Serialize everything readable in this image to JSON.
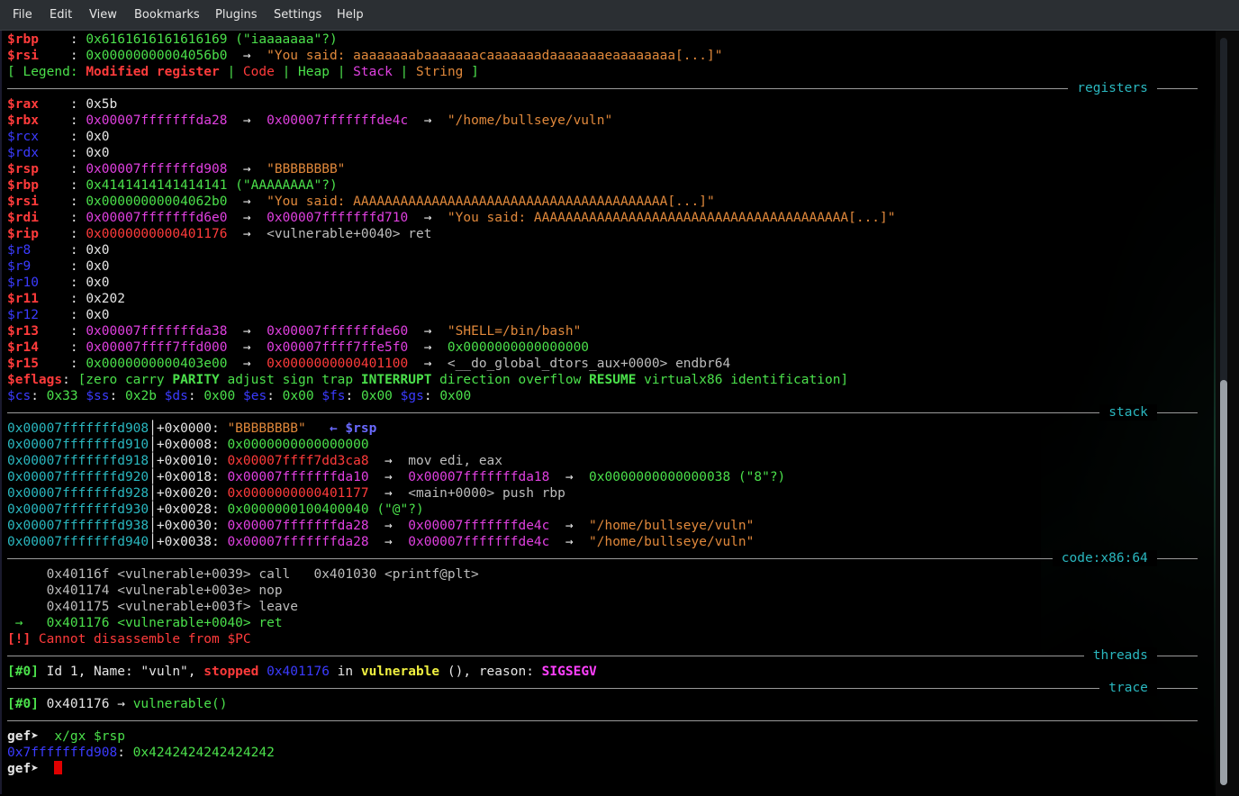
{
  "menu": [
    "File",
    "Edit",
    "View",
    "Bookmarks",
    "Plugins",
    "Settings",
    "Help"
  ],
  "pre": {
    "rbp_name": "$rbp",
    "rbp_val": "0x6161616161616169",
    "rbp_str": " (\"iaaaaaaa\"?)",
    "rsi_name": "$rsi",
    "rsi_val": "0x00000000004056b0",
    "rsi_str": "\"You said: aaaaaaaabaaaaaaacaaaaaaadaaaaaaaeaaaaaaaa[...]\"",
    "legend_open": "[ Legend: ",
    "legend_mod": "Modified register",
    "legend_code": "Code",
    "legend_heap": "Heap",
    "legend_stack": "Stack",
    "legend_string": "String",
    "legend_close": " ]"
  },
  "sections": {
    "registers": "registers",
    "stack": "stack",
    "code": "code:x86:64",
    "threads": "threads",
    "trace": "trace"
  },
  "registers": [
    {
      "name": "$rax",
      "c": "red",
      "val": "0x5b",
      "vc": "white"
    },
    {
      "name": "$rbx",
      "c": "red",
      "val": "0x00007fffffffda28",
      "vc": "mag",
      "a1": "0x00007fffffffde4c",
      "a1c": "mag",
      "s": "\"/home/bullseye/vuln\"",
      "sc": "orange"
    },
    {
      "name": "$rcx",
      "c": "blue",
      "val": "0x0",
      "vc": "white"
    },
    {
      "name": "$rdx",
      "c": "blue",
      "val": "0x0",
      "vc": "white"
    },
    {
      "name": "$rsp",
      "c": "red",
      "val": "0x00007fffffffd908",
      "vc": "mag",
      "s": "\"BBBBBBBB\"",
      "sc": "orange"
    },
    {
      "name": "$rbp",
      "c": "red",
      "val": "0x4141414141414141",
      "vc": "green",
      "tail": " (\"AAAAAAAA\"?)"
    },
    {
      "name": "$rsi",
      "c": "red",
      "val": "0x00000000004062b0",
      "vc": "green",
      "s": "\"You said: AAAAAAAAAAAAAAAAAAAAAAAAAAAAAAAAAAAAAAAA[...]\"",
      "sc": "orange"
    },
    {
      "name": "$rdi",
      "c": "red",
      "val": "0x00007fffffffd6e0",
      "vc": "mag",
      "a1": "0x00007fffffffd710",
      "a1c": "mag",
      "s": "\"You said: AAAAAAAAAAAAAAAAAAAAAAAAAAAAAAAAAAAAAAAA[...]\"",
      "sc": "orange"
    },
    {
      "name": "$rip",
      "c": "red",
      "val": "0x0000000000401176",
      "vc": "red",
      "s": "<vulnerable+0040> ret",
      "sc": "gray"
    },
    {
      "name": "$r8",
      "c": "blue",
      "val": "0x0",
      "vc": "white"
    },
    {
      "name": "$r9",
      "c": "blue",
      "val": "0x0",
      "vc": "white"
    },
    {
      "name": "$r10",
      "c": "blue",
      "val": "0x0",
      "vc": "white"
    },
    {
      "name": "$r11",
      "c": "red",
      "val": "0x202",
      "vc": "white"
    },
    {
      "name": "$r12",
      "c": "blue",
      "val": "0x0",
      "vc": "white"
    },
    {
      "name": "$r13",
      "c": "red",
      "val": "0x00007fffffffda38",
      "vc": "mag",
      "a1": "0x00007fffffffde60",
      "a1c": "mag",
      "s": "\"SHELL=/bin/bash\"",
      "sc": "orange"
    },
    {
      "name": "$r14",
      "c": "red",
      "val": "0x00007ffff7ffd000",
      "vc": "mag",
      "a1": "0x00007ffff7ffe5f0",
      "a1c": "mag",
      "s": "0x0000000000000000",
      "sc": "green"
    },
    {
      "name": "$r15",
      "c": "red",
      "val": "0x0000000000403e00",
      "vc": "green",
      "a1": "0x0000000000401100",
      "a1c": "red",
      "s": "<__do_global_dtors_aux+0000> endbr64",
      "sc": "gray"
    }
  ],
  "eflags": {
    "name": "$eflags",
    "parts": [
      {
        "t": "[zero carry ",
        "b": false
      },
      {
        "t": "PARITY",
        "b": true
      },
      {
        "t": " adjust sign trap ",
        "b": false
      },
      {
        "t": "INTERRUPT",
        "b": true
      },
      {
        "t": " direction overflow ",
        "b": false
      },
      {
        "t": "RESUME",
        "b": true
      },
      {
        "t": " virtualx86 identification]",
        "b": false
      }
    ]
  },
  "segments": [
    {
      "n": "$cs",
      "v": "0x33"
    },
    {
      "n": "$ss",
      "v": "0x2b"
    },
    {
      "n": "$ds",
      "v": "0x00"
    },
    {
      "n": "$es",
      "v": "0x00"
    },
    {
      "n": "$fs",
      "v": "0x00"
    },
    {
      "n": "$gs",
      "v": "0x00"
    }
  ],
  "stack": [
    {
      "addr": "0x00007fffffffd908",
      "off": "+0x0000:",
      "v": "\"BBBBBBBB\"",
      "vc": "orange",
      "extra": "   ← $rsp",
      "ec": "rsp"
    },
    {
      "addr": "0x00007fffffffd910",
      "off": "+0x0008:",
      "v": "0x0000000000000000",
      "vc": "green"
    },
    {
      "addr": "0x00007fffffffd918",
      "off": "+0x0010:",
      "v": "0x00007ffff7dd3ca8",
      "vc": "red",
      "a1": "mov edi, eax",
      "a1c": "gray"
    },
    {
      "addr": "0x00007fffffffd920",
      "off": "+0x0018:",
      "v": "0x00007fffffffda10",
      "vc": "mag",
      "a1": "0x00007fffffffda18",
      "a1c": "mag",
      "a2": "0x0000000000000038 (\"8\"?)",
      "a2c": "green"
    },
    {
      "addr": "0x00007fffffffd928",
      "off": "+0x0020:",
      "v": "0x0000000000401177",
      "vc": "red",
      "a1": "<main+0000> push rbp",
      "a1c": "gray"
    },
    {
      "addr": "0x00007fffffffd930",
      "off": "+0x0028:",
      "v": "0x0000000100400040 (\"@\"?)",
      "vc": "green"
    },
    {
      "addr": "0x00007fffffffd938",
      "off": "+0x0030:",
      "v": "0x00007fffffffda28",
      "vc": "mag",
      "a1": "0x00007fffffffde4c",
      "a1c": "mag",
      "a2": "\"/home/bullseye/vuln\"",
      "a2c": "orange"
    },
    {
      "addr": "0x00007fffffffd940",
      "off": "+0x0038:",
      "v": "0x00007fffffffda28",
      "vc": "mag",
      "a1": "0x00007fffffffde4c",
      "a1c": "mag",
      "a2": "\"/home/bullseye/vuln\"",
      "a2c": "orange"
    }
  ],
  "code": [
    {
      "prefix": "     ",
      "t": "0x40116f <vulnerable+0039> call   0x401030 <printf@plt>",
      "c": "gray"
    },
    {
      "prefix": "     ",
      "t": "0x401174 <vulnerable+003e> nop",
      "c": "gray"
    },
    {
      "prefix": "     ",
      "t": "0x401175 <vulnerable+003f> leave",
      "c": "gray"
    },
    {
      "prefix": " →   ",
      "t": "0x401176 <vulnerable+0040> ret",
      "c": "green"
    }
  ],
  "code_err": {
    "tag": "[!]",
    "msg": " Cannot disassemble from $PC"
  },
  "thread": {
    "tag": "[#0]",
    "p1": " Id 1, Name: \"vuln\", ",
    "stopped": "stopped",
    "addr": " 0x401176",
    "p2": " in ",
    "func": "vulnerable",
    "p3": " (), reason: ",
    "reason": "SIGSEGV"
  },
  "trace": {
    "tag": "[#0]",
    "addr": " 0x401176",
    "arrow": " → ",
    "func": "vulnerable()"
  },
  "prompt1": {
    "p": "gef➤",
    "cmd": "  x/gx $rsp"
  },
  "out": {
    "addr": "0x7fffffffd908",
    "colon": ":",
    "val": " 0x4242424242424242"
  },
  "prompt2": {
    "p": "gef➤",
    "cmd": "  "
  }
}
